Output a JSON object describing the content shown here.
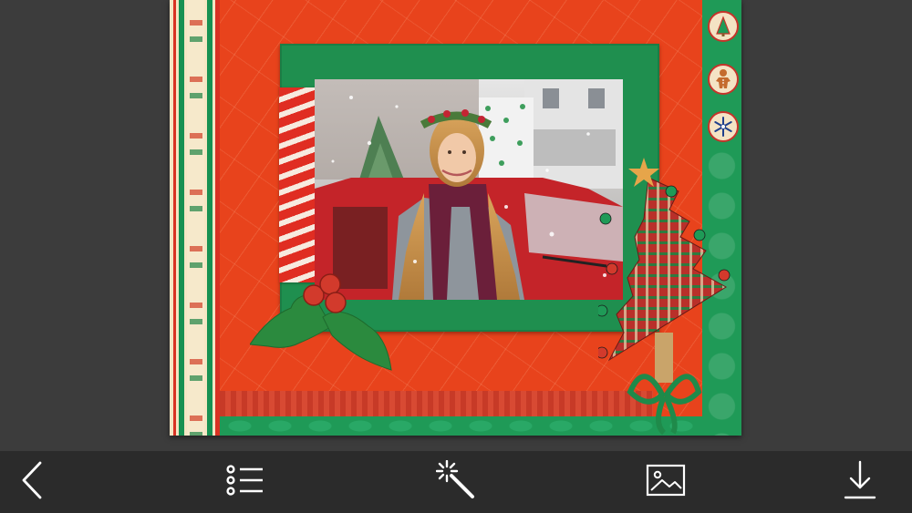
{
  "editor": {
    "frame_theme": "christmas",
    "photo_subject": "woman-in-christmas-wreath"
  },
  "card": {
    "badges": [
      {
        "icon": "christmas-tree-ornament-icon"
      },
      {
        "icon": "gingerbread-man-icon"
      },
      {
        "icon": "snowflake-icon"
      }
    ]
  },
  "toolbar": {
    "buttons": [
      {
        "icon": "back-chevron-icon"
      },
      {
        "icon": "list-icon"
      },
      {
        "icon": "magic-wand-icon"
      },
      {
        "icon": "image-icon"
      },
      {
        "icon": "download-icon"
      }
    ]
  },
  "colors": {
    "toolbar_bg": "#2b2b2b",
    "icon": "#ffffff",
    "card_red": "#e8431c",
    "card_green": "#1f9a57"
  }
}
